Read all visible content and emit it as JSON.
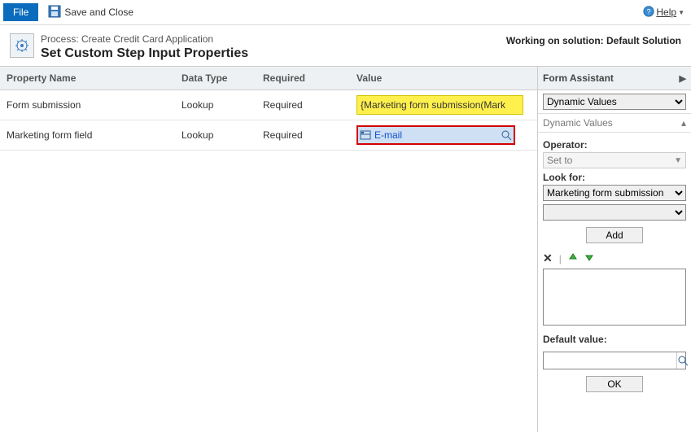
{
  "toolbar": {
    "file_label": "File",
    "save_close_label": "Save and Close",
    "help_label": "Help"
  },
  "header": {
    "process_label": "Process: Create Credit Card Application",
    "title": "Set Custom Step Input Properties",
    "solution_label": "Working on solution: Default Solution"
  },
  "grid": {
    "headers": {
      "name": "Property Name",
      "type": "Data Type",
      "required": "Required",
      "value": "Value"
    },
    "rows": [
      {
        "name": "Form submission",
        "type": "Lookup",
        "required": "Required",
        "value": "{Marketing form submission(Mark"
      },
      {
        "name": "Marketing form field",
        "type": "Lookup",
        "required": "Required",
        "value": "E-mail"
      }
    ]
  },
  "assistant": {
    "title": "Form Assistant",
    "dropdown_selected": "Dynamic Values",
    "section_label": "Dynamic Values",
    "operator_label": "Operator:",
    "operator_value": "Set to",
    "lookfor_label": "Look for:",
    "lookfor_value": "Marketing form submission",
    "lookfor_sub": "",
    "add_label": "Add",
    "default_label": "Default value:",
    "ok_label": "OK"
  }
}
